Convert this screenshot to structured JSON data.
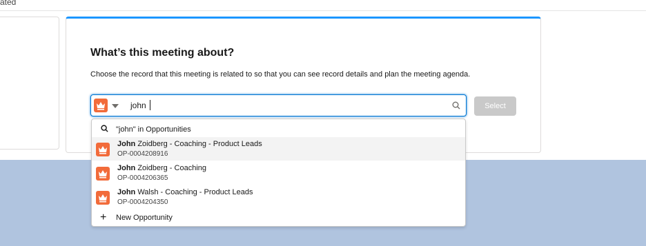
{
  "top": {
    "partial_text": "ated"
  },
  "card": {
    "heading": "What’s this meeting about?",
    "subtext": "Choose the record that this meeting is related to so that you can see record details and plan the meeting agenda."
  },
  "search": {
    "value": "john",
    "object_icon": "crown-icon",
    "select_label": "Select"
  },
  "dropdown": {
    "search_label": "\"john\" in Opportunities",
    "items": [
      {
        "bold": "John",
        "rest": " Zoidberg - Coaching - Product Leads",
        "sub": "OP-0004208916"
      },
      {
        "bold": "John",
        "rest": " Zoidberg - Coaching",
        "sub": "OP-0004206365"
      },
      {
        "bold": "John",
        "rest": " Walsh - Coaching - Product Leads",
        "sub": "OP-0004204350"
      }
    ],
    "new_label": "New Opportunity"
  },
  "colors": {
    "accent": "#0176d3",
    "object_icon": "#f26b3a",
    "background_lower": "#b0c4df",
    "card_top_border": "#1b96ff"
  }
}
